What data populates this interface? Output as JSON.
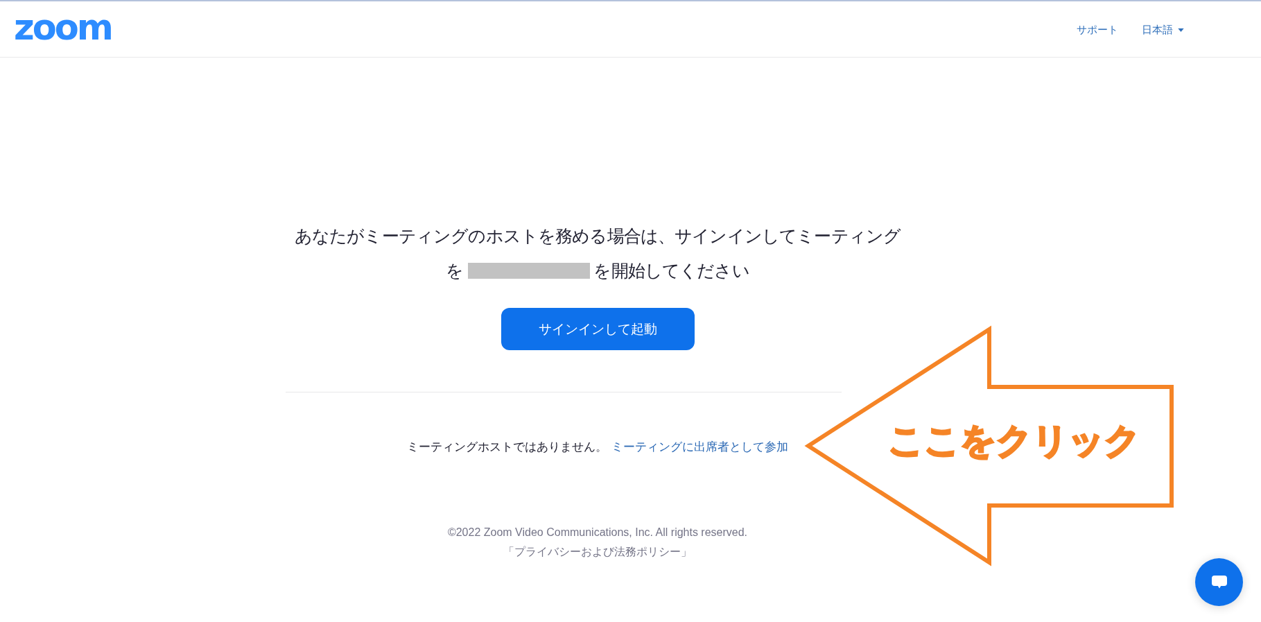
{
  "header": {
    "logo": "zoom",
    "nav": [
      {
        "kind": "link",
        "label": "サポート"
      },
      {
        "kind": "dropdown",
        "label": "日本語"
      }
    ]
  },
  "message": {
    "line_1": "あなたがミーティングのホストを務める場合は、サインインしてミーティング",
    "line_2_before": "を",
    "redacted": true,
    "line_2_after": "を開始してください"
  },
  "primary_button": {
    "label": "サインインして起動"
  },
  "join": {
    "text": "ミーティングホストではありません。",
    "link": "ミーティングに出席者として参加"
  },
  "footer": {
    "copyright": "©2022 Zoom Video Communications, Inc. All rights reserved.",
    "policy_link": "「プライバシーおよび法務ポリシー」"
  },
  "annotation": {
    "kind": "arrow",
    "text": "ここをクリック"
  }
}
